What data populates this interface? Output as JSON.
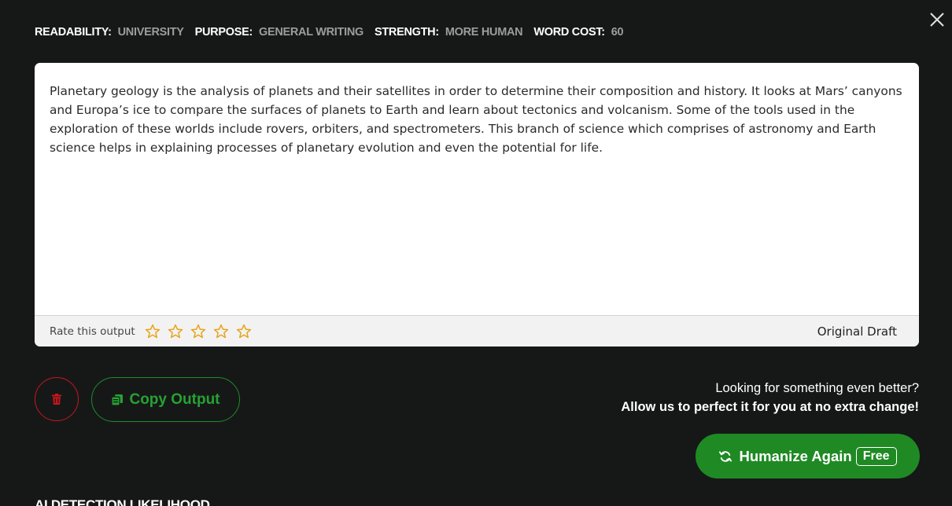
{
  "settings": {
    "readability_label": "READABILITY:",
    "readability_value": "UNIVERSITY",
    "purpose_label": "PURPOSE:",
    "purpose_value": "GENERAL WRITING",
    "strength_label": "STRENGTH:",
    "strength_value": "MORE HUMAN",
    "word_cost_label": "WORD COST:",
    "word_cost_value": "60"
  },
  "output": {
    "text": "Planetary geology is the analysis of planets and their satellites in order to determine their composition and history. It looks at Mars’ canyons and Europa’s ice to compare the surfaces of planets to Earth and learn about tectonics and volcanism. Some of the tools used in the exploration of these worlds include rovers, orbiters, and spectrometers. This branch of science which comprises of astronomy and Earth science helps in explaining processes of planetary evolution and even the potential for life.",
    "rate_label": "Rate this output",
    "rating": 0,
    "rating_max": 5,
    "draft_label": "Original Draft"
  },
  "actions": {
    "copy_label": "Copy Output"
  },
  "promo": {
    "line1": "Looking for something even better?",
    "line2": "Allow us to perfect it for you at no extra change!"
  },
  "humanize": {
    "label": "Humanize Again",
    "badge": "Free"
  },
  "ai_detection": {
    "heading": "AI DETECTION LIKELIHOOD"
  },
  "icons": {
    "close": "close-icon",
    "star": "star-outline-icon",
    "trash": "trash-icon",
    "copy": "copy-icon",
    "refresh": "refresh-icon"
  },
  "colors": {
    "background": "#161818",
    "accent_green": "#1f8a24",
    "copy_green": "#26a232",
    "danger_red": "#c8161d",
    "star_yellow": "#e8a317",
    "muted_value": "#9c9c9c"
  }
}
